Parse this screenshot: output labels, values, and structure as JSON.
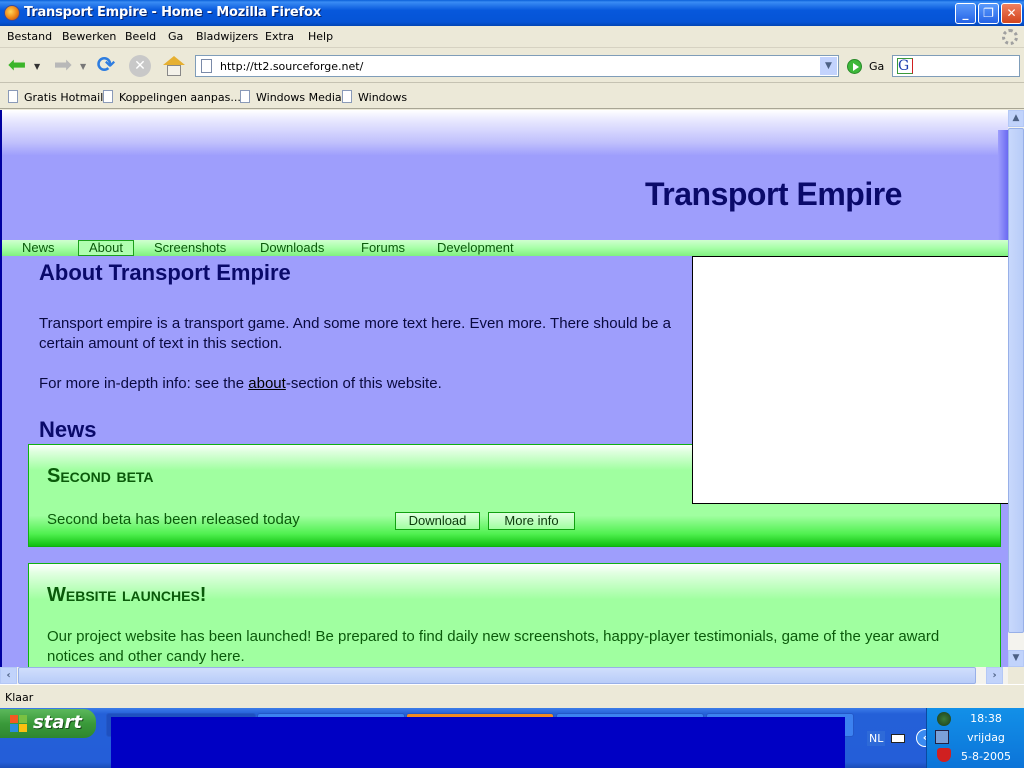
{
  "window": {
    "title": "Transport Empire - Home - Mozilla Firefox",
    "controls": {
      "minimize": "_",
      "restore": "❐",
      "close": "✕"
    }
  },
  "menubar": {
    "items": [
      "Bestand",
      "Bewerken",
      "Beeld",
      "Ga",
      "Bladwijzers",
      "Extra",
      "Help"
    ]
  },
  "toolbar": {
    "url": "http://tt2.sourceforge.net/",
    "go_label": "Ga",
    "search_value": ""
  },
  "bookmarks": {
    "items": [
      "Gratis Hotmail",
      "Koppelingen aanpas...",
      "Windows Media",
      "Windows"
    ]
  },
  "page": {
    "site_title": "Transport Empire",
    "nav": {
      "items": [
        "News",
        "About",
        "Screenshots",
        "Downloads",
        "Forums",
        "Development"
      ],
      "active": "About"
    },
    "about": {
      "title": "About Transport Empire",
      "text": "Transport empire is a transport game. And some more text here. Even more. There should be a certain amount of text in this section.",
      "more_prefix": "For more in-depth info: see the ",
      "more_link": "about",
      "more_suffix": "-section of this website."
    },
    "news": {
      "title": "News",
      "items": [
        {
          "heading": "Second beta",
          "body": "Second beta has been released today",
          "buttons": [
            "Download",
            "More info"
          ]
        },
        {
          "heading": "Website launches!",
          "body": "Our project website has been launched! Be prepared to find daily new screenshots, happy-player testimonials, game of the year award notices and other candy here."
        }
      ]
    }
  },
  "statusbar": {
    "text": "Klaar"
  },
  "taskbar": {
    "start_label": "start",
    "language": "NL",
    "clock": {
      "time": "18:38",
      "day": "vrijdag",
      "date": "5-8-2005"
    }
  },
  "colors": {
    "page_bg": "#9e9efc",
    "title_color": "#0a0a6a",
    "nav_green": "#a8ffa8",
    "news_text": "#0a5a0a"
  }
}
